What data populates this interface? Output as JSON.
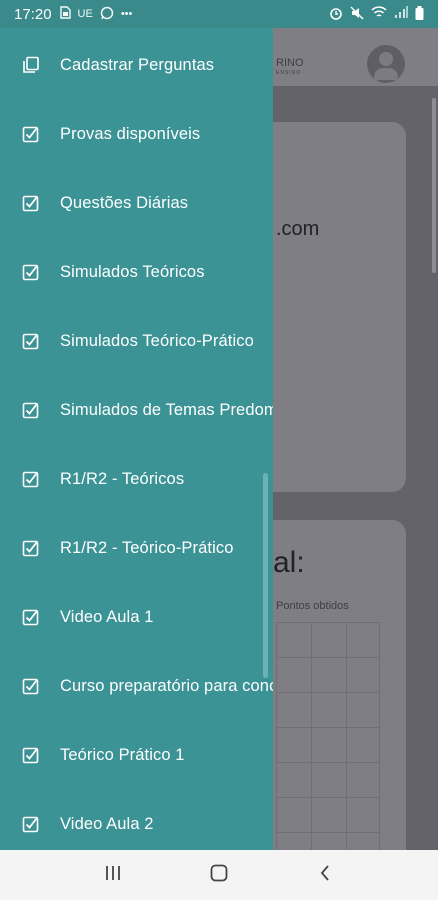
{
  "status_bar": {
    "time": "17:20",
    "left_icons": [
      "sim-icon",
      "ue-icon",
      "whatsapp-icon",
      "more-icon"
    ],
    "ue_text": "UE",
    "more_text": "•••",
    "right_icons": [
      "alarm-icon",
      "mute-icon",
      "wifi-icon",
      "signal-icon",
      "battery-icon"
    ]
  },
  "background_app": {
    "brand_text": "RINO",
    "brand_sub": "ENSINO",
    "email_fragment": ".com",
    "section_title_fragment": "al:",
    "chart_legend": "Pontos obtidos"
  },
  "drawer": {
    "accent_color": "#3b9396",
    "items": [
      {
        "label": "Cadastrar Perguntas",
        "icon": "copy-icon"
      },
      {
        "label": "Provas disponíveis",
        "icon": "checkbox-icon"
      },
      {
        "label": "Questões Diárias",
        "icon": "checkbox-icon"
      },
      {
        "label": "Simulados Teóricos",
        "icon": "checkbox-icon"
      },
      {
        "label": "Simulados Teórico-Prático",
        "icon": "checkbox-icon"
      },
      {
        "label": "Simulados de Temas Predominantes",
        "icon": "checkbox-icon"
      },
      {
        "label": "R1/R2 - Teóricos",
        "icon": "checkbox-icon"
      },
      {
        "label": "R1/R2 - Teórico-Prático",
        "icon": "checkbox-icon"
      },
      {
        "label": "Video Aula 1",
        "icon": "checkbox-icon"
      },
      {
        "label": "Curso preparatório para concursos",
        "icon": "checkbox-icon"
      },
      {
        "label": "Teórico Prático 1",
        "icon": "checkbox-icon"
      },
      {
        "label": "Video Aula 2",
        "icon": "checkbox-icon"
      }
    ]
  },
  "nav_bar": {
    "buttons": [
      "recent-apps-icon",
      "home-icon",
      "back-icon"
    ]
  }
}
